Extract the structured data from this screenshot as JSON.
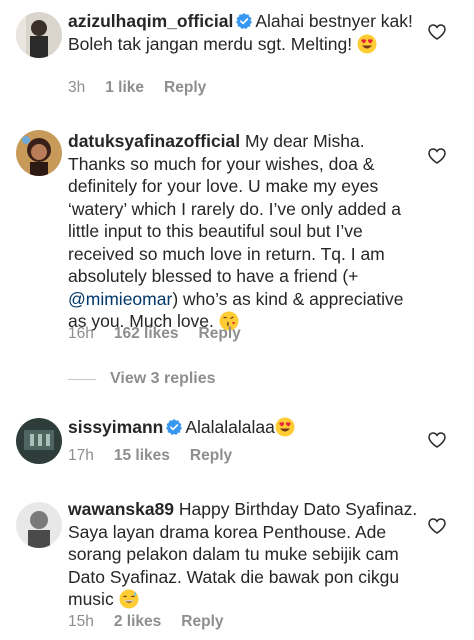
{
  "comments": [
    {
      "username": "azizulhaqim_official",
      "verified": true,
      "text_parts": [
        "Alahai bestnyer kak! Boleh tak jangan merdu sgt. Melting! "
      ],
      "emoji": "heart-eyes-emoji",
      "time": "3h",
      "likes": "1 like",
      "reply": "Reply"
    },
    {
      "username": "datuksyafinazofficial",
      "verified": false,
      "text_before_mention": "My dear Misha. Thanks so much for your wishes, doa & definitely for your love. U make my eyes ‘watery’ which I rarely do. I’ve only added a little input to this beautiful soul but I’ve received so much love in return. Tq. I am absolutely blessed to have a friend (+ ",
      "mention": "@mimieomar",
      "text_after_mention": ") who’s as kind & appreciative as you. Much love. ",
      "emoji": "kissing-heart-emoji",
      "time": "16h",
      "likes": "162 likes",
      "reply": "Reply",
      "view_replies": "View 3 replies"
    },
    {
      "username": "sissyimann",
      "verified": true,
      "text": "Alalalalalaa",
      "emoji": "heart-eyes-emoji",
      "time": "17h",
      "likes": "15 likes",
      "reply": "Reply"
    },
    {
      "username": "wawanska89",
      "verified": false,
      "text": "Happy Birthday Dato Syafinaz. Saya layan drama korea Penthouse. Ade sorang pelakon dalam tu muke sebijik cam Dato Syafinaz. Watak die bawak pon cikgu music ",
      "emoji": "sweat-smile-emoji",
      "time": "15h",
      "likes": "2 likes",
      "reply": "Reply"
    }
  ],
  "colors": {
    "text": "#262626",
    "meta": "#8e8e8e",
    "mention": "#00376b",
    "verified": "#3897f0"
  }
}
